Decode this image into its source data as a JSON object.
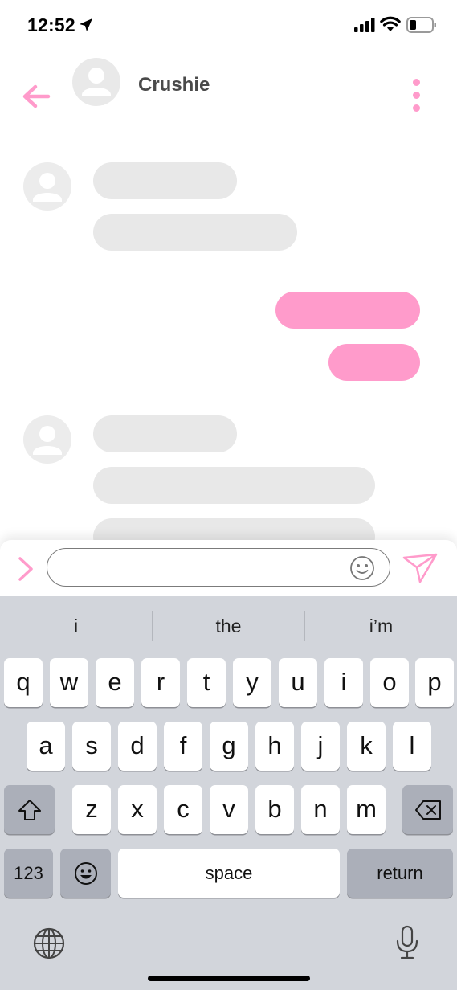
{
  "status_bar": {
    "time": "12:52"
  },
  "header": {
    "contact_name": "Crushie"
  },
  "colors": {
    "accent": "#ff9bcb",
    "placeholder_gray": "#e8e8e8",
    "keyboard_bg": "#d2d5db"
  },
  "input": {
    "placeholder": "",
    "value": ""
  },
  "keyboard": {
    "suggestions": [
      "i",
      "the",
      "i’m"
    ],
    "row1": [
      "q",
      "w",
      "e",
      "r",
      "t",
      "y",
      "u",
      "i",
      "o",
      "p"
    ],
    "row2": [
      "a",
      "s",
      "d",
      "f",
      "g",
      "h",
      "j",
      "k",
      "l"
    ],
    "row3": [
      "z",
      "x",
      "c",
      "v",
      "b",
      "n",
      "m"
    ],
    "numbers_label": "123",
    "space_label": "space",
    "return_label": "return"
  },
  "icons": [
    "back-arrow-icon",
    "avatar-icon",
    "more-vertical-icon",
    "chevron-right-icon",
    "smiley-icon",
    "send-icon",
    "shift-icon",
    "backspace-icon",
    "emoji-keyboard-icon",
    "globe-icon",
    "microphone-icon"
  ]
}
